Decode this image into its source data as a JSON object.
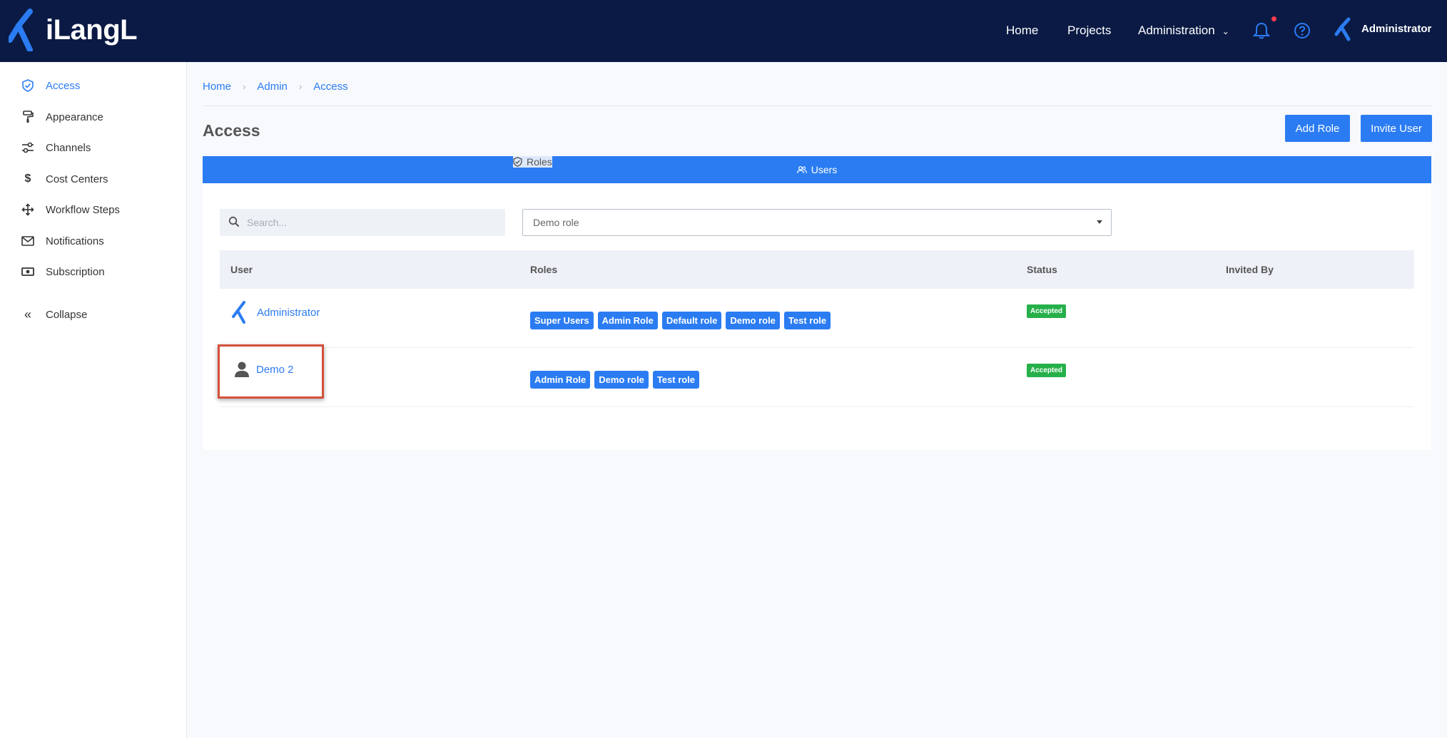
{
  "app": {
    "logo_text": "iLangL"
  },
  "topnav": {
    "home": "Home",
    "projects": "Projects",
    "administration": "Administration",
    "user": "Administrator"
  },
  "sidebar": {
    "items": [
      {
        "label": "Access",
        "icon": "shield-check-icon",
        "active": true
      },
      {
        "label": "Appearance",
        "icon": "paint-roller-icon"
      },
      {
        "label": "Channels",
        "icon": "sliders-icon"
      },
      {
        "label": "Cost Centers",
        "icon": "dollar-icon"
      },
      {
        "label": "Workflow Steps",
        "icon": "move-arrows-icon"
      },
      {
        "label": "Notifications",
        "icon": "envelope-icon"
      },
      {
        "label": "Subscription",
        "icon": "money-bill-icon"
      }
    ],
    "collapse": "Collapse"
  },
  "breadcrumb": [
    "Home",
    "Admin",
    "Access"
  ],
  "page": {
    "title": "Access",
    "add_role": "Add Role",
    "invite_user": "Invite User"
  },
  "tabs": {
    "roles": "Roles",
    "users": "Users",
    "active": "users"
  },
  "filters": {
    "search_placeholder": "Search...",
    "role_select": "Demo role"
  },
  "table": {
    "headers": {
      "user": "User",
      "roles": "Roles",
      "status": "Status",
      "invited_by": "Invited By"
    },
    "rows": [
      {
        "user": "Administrator",
        "roles": [
          "Super Users",
          "Admin Role",
          "Default role",
          "Demo role",
          "Test role"
        ],
        "status": "Accepted",
        "invited_by": ""
      },
      {
        "user": "Demo 2",
        "roles": [
          "Admin Role",
          "Demo role",
          "Test role"
        ],
        "status": "Accepted",
        "invited_by": ""
      }
    ]
  },
  "colors": {
    "topbar": "#0a1a44",
    "accent": "#2b7cf2",
    "status_accepted": "#25b04a",
    "highlight": "#d4503a"
  }
}
